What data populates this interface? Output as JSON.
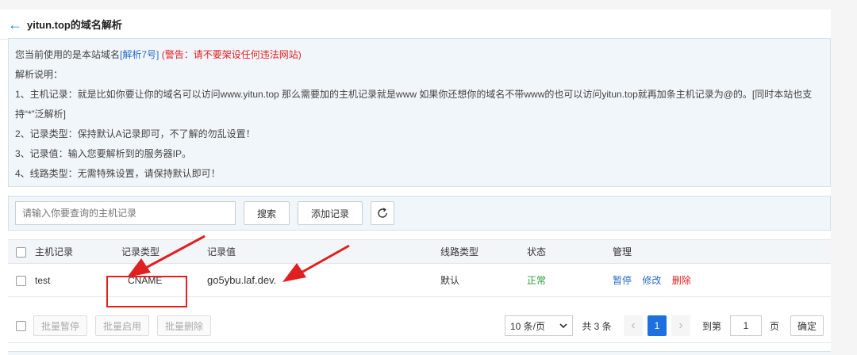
{
  "header": {
    "back_icon": "arrow-left-icon",
    "title": "yitun.top的域名解析"
  },
  "notice": {
    "line1_prefix": "您当前使用的是本站域名",
    "line1_link": "[解析7号]",
    "line1_warning": "(警告：请不要架设任何违法网站)",
    "line2": "解析说明：",
    "line3": "1、主机记录：就是比如你要让你的域名可以访问www.yitun.top 那么需要加的主机记录就是www 如果你还想你的域名不带www的也可以访问yitun.top就再加条主机记录为@的。[同时本站也支持“*”泛解析]",
    "line4": "2、记录类型：保持默认A记录即可，不了解的勿乱设置！",
    "line5": "3、记录值：输入您要解析到的服务器IP。",
    "line6": "4、线路类型：无需特殊设置，请保持默认即可！"
  },
  "toolbar": {
    "search_placeholder": "请输入你要查询的主机记录",
    "search_label": "搜索",
    "add_label": "添加记录",
    "refresh_icon": "refresh-icon"
  },
  "table": {
    "headers": [
      "主机记录",
      "记录类型",
      "记录值",
      "线路类型",
      "状态",
      "管理"
    ],
    "rows": [
      {
        "host": "test",
        "type": "CNAME",
        "value": "go5ybu.laf.dev.",
        "line": "默认",
        "status": "正常",
        "actions": [
          "暂停",
          "修改",
          "删除"
        ]
      }
    ]
  },
  "footer": {
    "batch_pause": "批量暂停",
    "batch_enable": "批量启用",
    "batch_delete": "批量删除",
    "page_size": "10 条/页",
    "total": "共 3 条",
    "prev": "‹",
    "current_page": "1",
    "next": "›",
    "goto_label": "到第",
    "goto_value": "1",
    "page_unit": "页",
    "confirm": "确定"
  },
  "colors": {
    "accent": "#2a6cc4",
    "warning": "#e02020",
    "ok": "#27a03b",
    "annotation": "#e02020"
  }
}
